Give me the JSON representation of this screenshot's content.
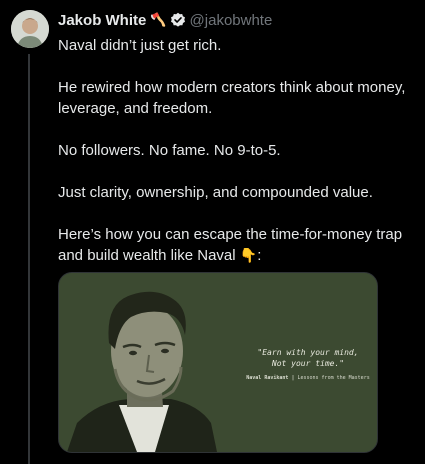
{
  "author": {
    "name": "Jakob White",
    "emoji": "🪓",
    "handle": "@jakobwhte"
  },
  "tweet": {
    "paragraphs": [
      "Naval didn’t just get rich.",
      "He rewired how modern creators think about money, leverage, and freedom.",
      "No followers. No fame. No 9-to-5.",
      "Just clarity, ownership, and compounded value."
    ],
    "last_paragraph": "Here’s how you can escape the time-for-money trap and build wealth like Naval",
    "pointing_emoji": "👇",
    "trailing": ":"
  },
  "media": {
    "quote": "\"Earn with your mind,\nNot your time.\"",
    "attribution_name": "Naval Ravikant",
    "attribution_separator": "|",
    "attribution_source": "Lessons from the Masters",
    "background_color": "#3c4a31"
  },
  "colors": {
    "background": "#000000",
    "text": "#e7e9ea",
    "muted": "#71767b",
    "verified": "#e7e9ea",
    "border": "#2f3336"
  }
}
